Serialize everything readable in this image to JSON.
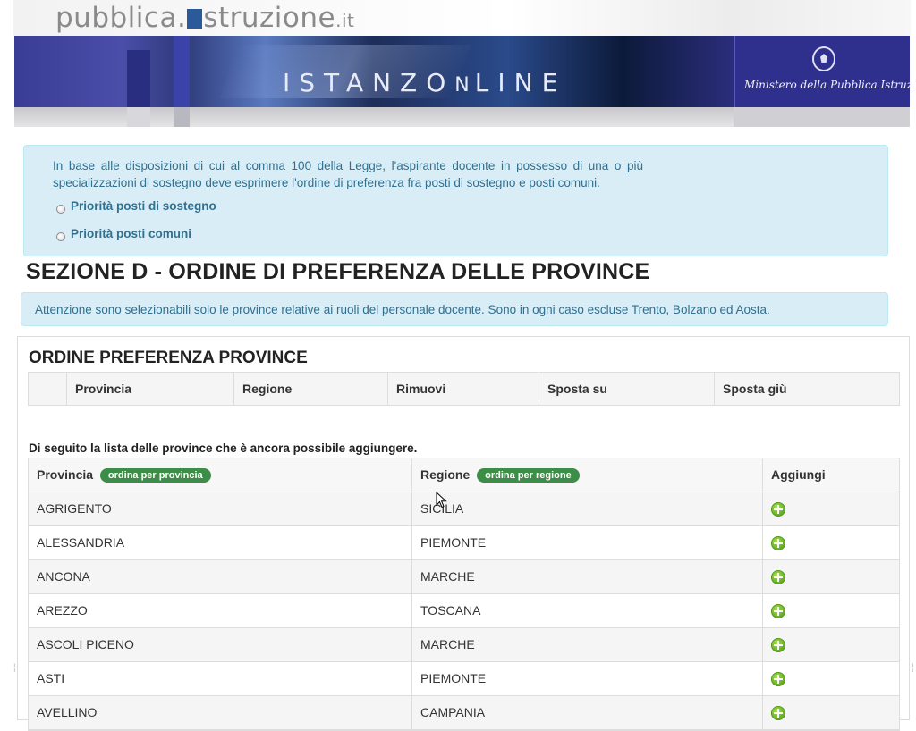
{
  "header": {
    "site_name_part1": "pubblica.",
    "site_name_part2": "struzione",
    "site_name_tld": ".it",
    "banner_istanze": "ISTANZ",
    "banner_on_o": "O",
    "banner_on_n": "N",
    "banner_line": "LINE",
    "ministero": "Ministero della Pubblica Istruzione"
  },
  "priorita": {
    "text": "In base alle disposizioni di cui al comma 100 della Legge, l'aspirante docente in possesso di una o più specializzazioni di sostegno deve esprimere l'ordine di preferenza fra posti di sostegno e posti comuni.",
    "option_sostegno": "Priorità posti di sostegno",
    "option_comuni": "Priorità posti comuni"
  },
  "section": {
    "title": "SEZIONE D - ORDINE DI PREFERENZA DELLE PROVINCE",
    "alert": "Attenzione sono selezionabili solo le province relative ai ruoli del personale docente. Sono in ogni caso escluse Trento, Bolzano ed Aosta."
  },
  "preferenza": {
    "title": "ORDINE PREFERENZA PROVINCE",
    "columns": {
      "provincia": "Provincia",
      "regione": "Regione",
      "rimuovi": "Rimuovi",
      "sposta_su": "Sposta su",
      "sposta_giu": "Sposta giù"
    }
  },
  "lista": {
    "caption": "Di seguito la lista delle province che è ancora possibile aggiungere.",
    "col_provincia": "Provincia",
    "sort_provincia": "ordina per provincia",
    "col_regione": "Regione",
    "sort_regione": "ordina per regione",
    "col_aggiungi": "Aggiungi",
    "rows": [
      {
        "provincia": "AGRIGENTO",
        "regione": "SICILIA"
      },
      {
        "provincia": "ALESSANDRIA",
        "regione": "PIEMONTE"
      },
      {
        "provincia": "ANCONA",
        "regione": "MARCHE"
      },
      {
        "provincia": "AREZZO",
        "regione": "TOSCANA"
      },
      {
        "provincia": "ASCOLI PICENO",
        "regione": "MARCHE"
      },
      {
        "provincia": "ASTI",
        "regione": "PIEMONTE"
      },
      {
        "provincia": "AVELLINO",
        "regione": "CAMPANIA"
      }
    ],
    "add_icon_color": "#6bb526",
    "badge_color": "#3c8d47"
  },
  "colors": {
    "alert_bg": "#d9edf7",
    "alert_text": "#31708f"
  }
}
